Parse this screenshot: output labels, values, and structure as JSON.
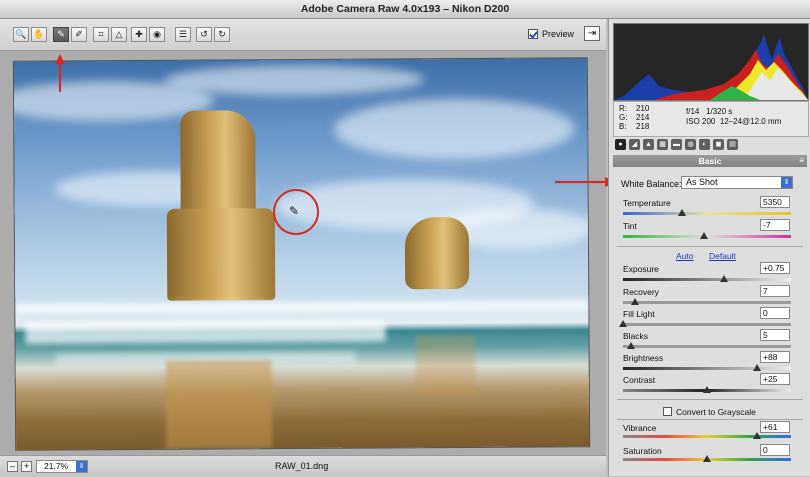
{
  "window": {
    "title": "Adobe Camera Raw 4.0x193  –  Nikon D200"
  },
  "toolbar": {
    "tools": [
      {
        "name": "zoom-tool",
        "glyph": "🔍"
      },
      {
        "name": "hand-tool",
        "glyph": "✋"
      },
      {
        "name": "white-balance-tool",
        "glyph": "✎"
      },
      {
        "name": "color-sampler-tool",
        "glyph": "✐"
      },
      {
        "name": "crop-tool",
        "glyph": "⌗"
      },
      {
        "name": "straighten-tool",
        "glyph": "△"
      },
      {
        "name": "retouch-tool",
        "glyph": "✚"
      },
      {
        "name": "red-eye-tool",
        "glyph": "◉"
      },
      {
        "name": "preferences-tool",
        "glyph": "☰"
      },
      {
        "name": "rotate-left-tool",
        "glyph": "↺"
      },
      {
        "name": "rotate-right-tool",
        "glyph": "↻"
      }
    ],
    "preview_label": "Preview",
    "preview_checked": true
  },
  "status": {
    "zoom": "21.7%",
    "filename": "RAW_01.dng"
  },
  "readout": {
    "r_label": "R:",
    "g_label": "G:",
    "b_label": "B:",
    "r": "210",
    "g": "214",
    "b": "218",
    "aperture": "f/14",
    "shutter": "1/320 s",
    "iso": "ISO 200",
    "lens": "12–24@12.0 mm"
  },
  "panel": {
    "title": "Basic",
    "white_balance_label": "White Balance:",
    "white_balance_value": "As Shot",
    "auto_link": "Auto",
    "default_link": "Default",
    "grayscale_label": "Convert to Grayscale",
    "sliders": {
      "temperature": {
        "label": "Temperature",
        "value": "5350",
        "pos": 0.35
      },
      "tint": {
        "label": "Tint",
        "value": "-7",
        "pos": 0.48
      },
      "exposure": {
        "label": "Exposure",
        "value": "+0.75",
        "pos": 0.6
      },
      "recovery": {
        "label": "Recovery",
        "value": "7",
        "pos": 0.07
      },
      "fill_light": {
        "label": "Fill Light",
        "value": "0",
        "pos": 0.0
      },
      "blacks": {
        "label": "Blacks",
        "value": "5",
        "pos": 0.05
      },
      "brightness": {
        "label": "Brightness",
        "value": "+88",
        "pos": 0.8
      },
      "contrast": {
        "label": "Contrast",
        "value": "+25",
        "pos": 0.5
      },
      "vibrance": {
        "label": "Vibrance",
        "value": "+61",
        "pos": 0.8
      },
      "saturation": {
        "label": "Saturation",
        "value": "0",
        "pos": 0.5
      }
    }
  },
  "colors": {
    "accent": "#3c6fd1",
    "annotation": "#d42a2a"
  }
}
